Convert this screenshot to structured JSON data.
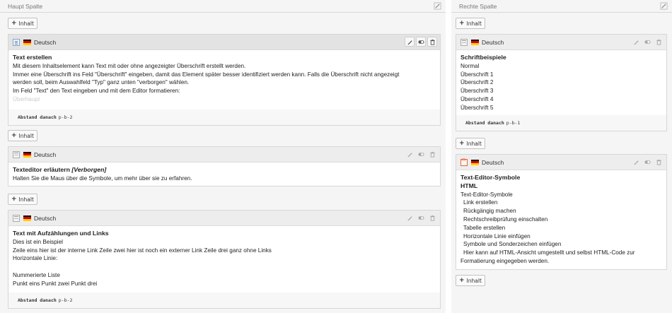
{
  "main_column": {
    "title": "Haupt Spalte",
    "add_label": "Inhalt",
    "cards": [
      {
        "language": "Deutsch",
        "type_icon": "text-content-icon",
        "heading": "Text erstellen",
        "lines": [
          "Mit diesem Inhaltselement kann Text mit oder ohne angezeigter Überschrift erstellt werden.",
          "Immer eine Überschrift ins Feld \"Überschrift\" eingeben, damit das Element später besser identifiziert werden kann. Falls die Überschrift nicht angezeigt",
          "werden soll, beim Auswahlfeld \"Typ\" ganz unten \"verborgen\" wählen.",
          "Im Feld \"Text\" den Text eingeben und mit dem Editor formatieren:"
        ],
        "faded_line": "Überhaupt",
        "footer_label": "Abstand danach",
        "footer_value": "p-b-2"
      },
      {
        "language": "Deutsch",
        "type_icon": "plain-content-icon",
        "heading": "Texteditor erläutern",
        "heading_suffix": "[Verborgen]",
        "lines": [
          "Halten Sie die Maus über die Symbole, um mehr über sie zu erfahren."
        ]
      },
      {
        "language": "Deutsch",
        "type_icon": "plain-content-icon",
        "heading": "Text mit Aufzählungen und Links",
        "lines": [
          "Dies ist ein Beispiel",
          "Zeile eins hier ist der interne Link Zeile zwei hier ist noch ein externer Link Zeile drei ganz ohne Links",
          "Horizontale Linie:",
          "",
          "Nummerierte Liste",
          "Punkt eins Punkt zwei Punkt drei"
        ],
        "footer_label": "Abstand danach",
        "footer_value": "p-b-2"
      }
    ]
  },
  "right_column": {
    "title": "Rechte Spalte",
    "add_label": "Inhalt",
    "cards": [
      {
        "language": "Deutsch",
        "type_icon": "plain-content-icon",
        "heading": "Schriftbeispiele",
        "lines": [
          "Normal",
          "Überschrift 1",
          "Überschrift 2",
          "Überschrift 3",
          "Überschrift 4",
          "Überschrift 5"
        ],
        "footer_label": "Abstand danach",
        "footer_value": "p-b-1"
      },
      {
        "language": "Deutsch",
        "type_icon": "html-content-icon",
        "heading": "Text-Editor-Symbole",
        "subheading": "HTML",
        "lines": [
          "Text-Editor-Symbole",
          " Link erstellen",
          " Rückgängig machen",
          " Rechtschreibprüfung einschalten",
          " Tabelle erstellen",
          " Horizontale Linie einfügen",
          " Symbole und Sonderzeichen einfügen",
          " Hier kann auf HTML-Ansicht umgestellt und selbst HTML-Code zur",
          "Formatierung eingegeben werden."
        ]
      }
    ]
  },
  "colors": {
    "flag_black": "#000000",
    "flag_red": "#dd0000",
    "flag_gold": "#ffce00"
  }
}
